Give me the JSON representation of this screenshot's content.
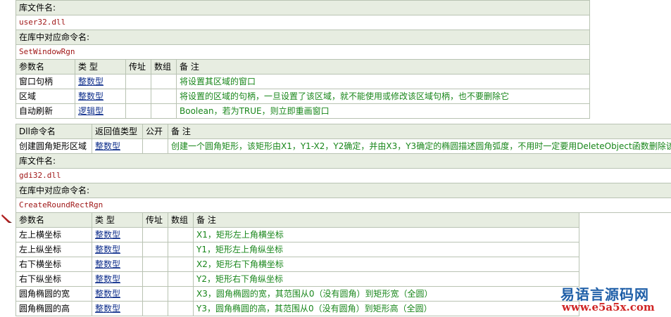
{
  "t1": {
    "lib_label": "库文件名:",
    "lib_value": "user32.dll",
    "cmd_label": "在库中对应命令名:",
    "cmd_value": "SetWindowRgn",
    "headers": [
      "参数名",
      "类 型",
      "传址",
      "数组",
      "备 注"
    ],
    "rows": [
      {
        "name": "窗口句柄",
        "type": "整数型",
        "byref": "",
        "array": "",
        "note": "将设置其区域的窗口"
      },
      {
        "name": "区域",
        "type": "整数型",
        "byref": "",
        "array": "",
        "note": "将设置的区域的句柄，一旦设置了该区域，就不能使用或修改该区域句柄，也不要删除它"
      },
      {
        "name": "自动刷新",
        "type": "逻辑型",
        "byref": "",
        "array": "",
        "note": "Boolean，若为TRUE，则立即重画窗口"
      }
    ]
  },
  "t2": {
    "headers": [
      "Dll命令名",
      "返回值类型",
      "公开",
      "备 注"
    ],
    "cmd": {
      "name": "创建圆角矩形区域",
      "type": "整数型",
      "public": "",
      "note": "创建一个圆角矩形，该矩形由X1，Y1-X2，Y2确定，并由X3，Y3确定的椭圆描述圆角弧度，不用时一定要用DeleteObject函数删除该区域"
    },
    "lib_label": "库文件名:",
    "lib_value": "gdi32.dll",
    "cmd_label": "在库中对应命令名:",
    "cmd_value": "CreateRoundRectRgn",
    "param_headers": [
      "参数名",
      "类 型",
      "传址",
      "数组",
      "备 注"
    ],
    "rows": [
      {
        "name": "左上横坐标",
        "type": "整数型",
        "byref": "",
        "array": "",
        "note": "X1，矩形左上角横坐标"
      },
      {
        "name": "左上纵坐标",
        "type": "整数型",
        "byref": "",
        "array": "",
        "note": "Y1，矩形左上角纵坐标"
      },
      {
        "name": "右下横坐标",
        "type": "整数型",
        "byref": "",
        "array": "",
        "note": "X2，矩形右下角横坐标"
      },
      {
        "name": "右下纵坐标",
        "type": "整数型",
        "byref": "",
        "array": "",
        "note": "Y2，矩形右下角纵坐标"
      },
      {
        "name": "圆角椭圆的宽",
        "type": "整数型",
        "byref": "",
        "array": "",
        "note": "X3，圆角椭圆的宽，其范围从0（没有圆角）到矩形宽（全圆）"
      },
      {
        "name": "圆角椭圆的高",
        "type": "整数型",
        "byref": "",
        "array": "",
        "note": "Y3，圆角椭圆的高，其范围从0（没有圆角）到矩形高（全圆）"
      }
    ]
  },
  "watermark": {
    "line1": "易语言源码网",
    "line2": "www.e5a5x.com"
  },
  "colors": {
    "header_bg": "#e7ede1",
    "border": "#b9c3b3",
    "type_link": "#10308c",
    "note_text": "#18861a",
    "mono_text": "#a01818"
  }
}
